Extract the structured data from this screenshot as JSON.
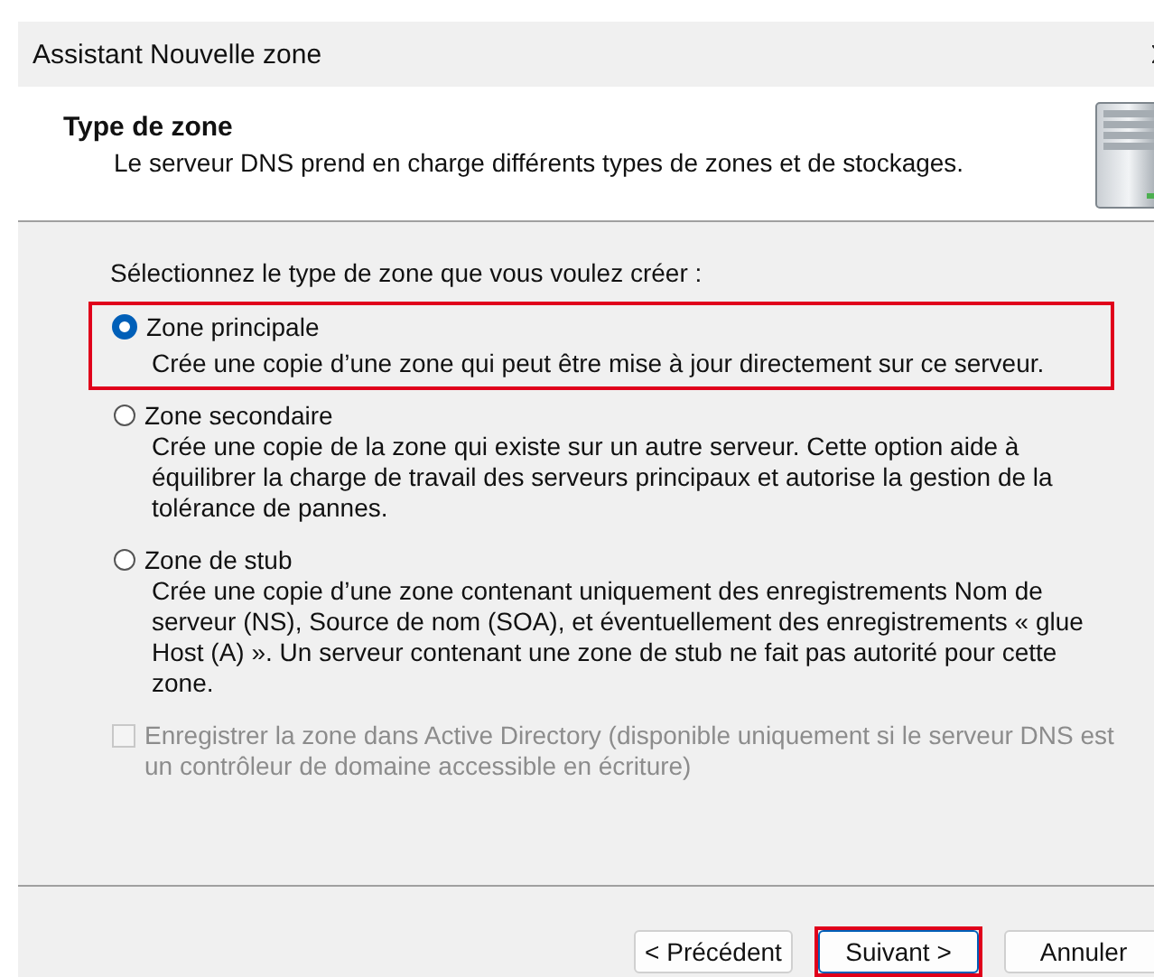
{
  "window": {
    "title": "Assistant Nouvelle zone"
  },
  "header": {
    "title": "Type de zone",
    "subtitle": "Le serveur DNS prend en charge différents types de zones et de stockages."
  },
  "prompt": "Sélectionnez le type de zone que vous voulez créer :",
  "options": [
    {
      "label": "Zone principale",
      "description": "Crée une copie d’une zone qui peut être mise à jour directement sur ce serveur.",
      "selected": true,
      "highlighted": true
    },
    {
      "label": "Zone secondaire",
      "description": "Crée une copie de la zone qui existe sur un autre serveur. Cette option aide à équilibrer la charge de travail des serveurs principaux et autorise la gestion de la tolérance de pannes.",
      "selected": false,
      "highlighted": false
    },
    {
      "label": "Zone de stub",
      "description": "Crée une copie d’une zone contenant uniquement des enregistrements Nom de serveur (NS), Source de nom (SOA), et éventuellement des enregistrements « glue Host (A) ». Un serveur contenant une zone de stub ne fait pas autorité pour cette zone.",
      "selected": false,
      "highlighted": false
    }
  ],
  "ad_checkbox": {
    "label": "Enregistrer la zone dans Active Directory (disponible uniquement si le serveur DNS est un contrôleur de domaine accessible en écriture)",
    "checked": false,
    "disabled": true
  },
  "buttons": [
    {
      "label": "< Précédent",
      "highlighted": false,
      "focused": false
    },
    {
      "label": "Suivant >",
      "highlighted": true,
      "focused": true
    },
    {
      "label": "Annuler",
      "highlighted": false,
      "focused": false
    }
  ]
}
